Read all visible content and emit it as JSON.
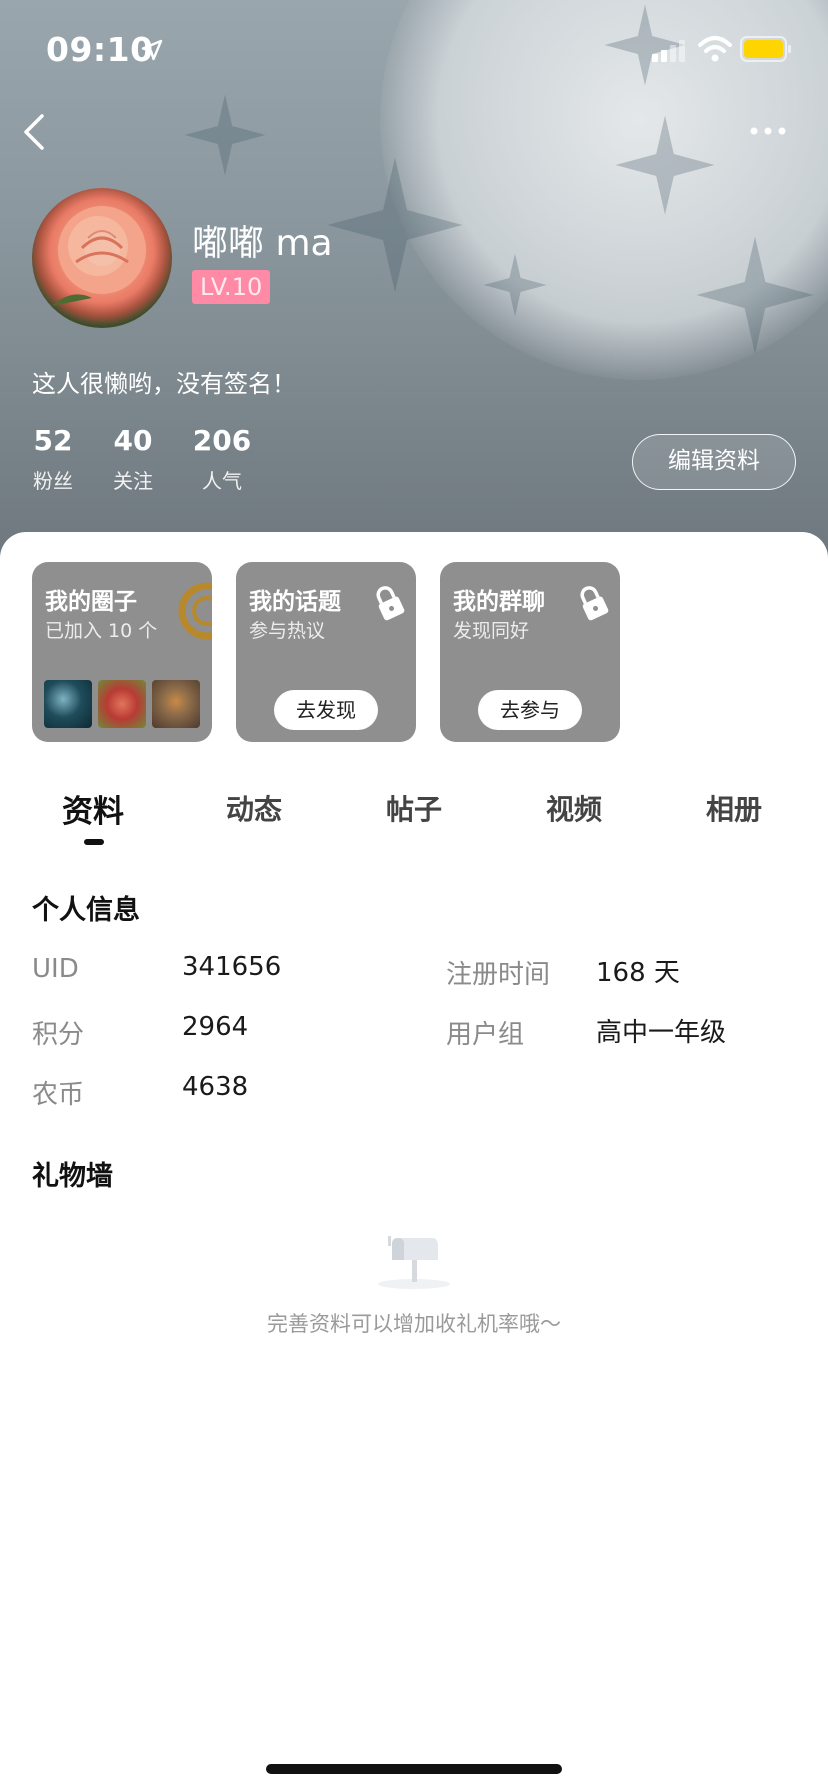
{
  "status_bar": {
    "time": "09:10",
    "icons": [
      "location-arrow-icon",
      "signal-icon",
      "wifi-icon",
      "battery-icon"
    ],
    "battery_color": "#ffd500"
  },
  "nav": {
    "back_icon": "chevron-left-icon",
    "more_icon": "more-dots-icon"
  },
  "profile": {
    "username": "嘟嘟 ma",
    "level": "LV.10",
    "level_color": "#ff8aa5",
    "signature": "这人很懒哟，没有签名！",
    "stats": [
      {
        "value": "52",
        "label": "粉丝"
      },
      {
        "value": "40",
        "label": "关注"
      },
      {
        "value": "206",
        "label": "人气"
      }
    ],
    "edit_label": "编辑资料"
  },
  "cards": [
    {
      "title": "我的圈子",
      "subtitle": "已加入 10 个"
    },
    {
      "title": "我的话题",
      "subtitle": "参与热议",
      "button": "去发现"
    },
    {
      "title": "我的群聊",
      "subtitle": "发现同好",
      "button": "去参与"
    }
  ],
  "tabs": [
    {
      "label": "资料",
      "active": true
    },
    {
      "label": "动态",
      "active": false
    },
    {
      "label": "帖子",
      "active": false
    },
    {
      "label": "视频",
      "active": false
    },
    {
      "label": "相册",
      "active": false
    }
  ],
  "personal_info": {
    "title": "个人信息",
    "fields": [
      {
        "label": "UID",
        "value": "341656"
      },
      {
        "label": "注册时间",
        "value": "168 天"
      },
      {
        "label": "积分",
        "value": "2964"
      },
      {
        "label": "用户组",
        "value": "高中一年级"
      },
      {
        "label": "农币",
        "value": "4638"
      }
    ]
  },
  "gift_wall": {
    "title": "礼物墙",
    "empty_icon": "mailbox-icon",
    "empty_text": "完善资料可以增加收礼机率哦～"
  }
}
